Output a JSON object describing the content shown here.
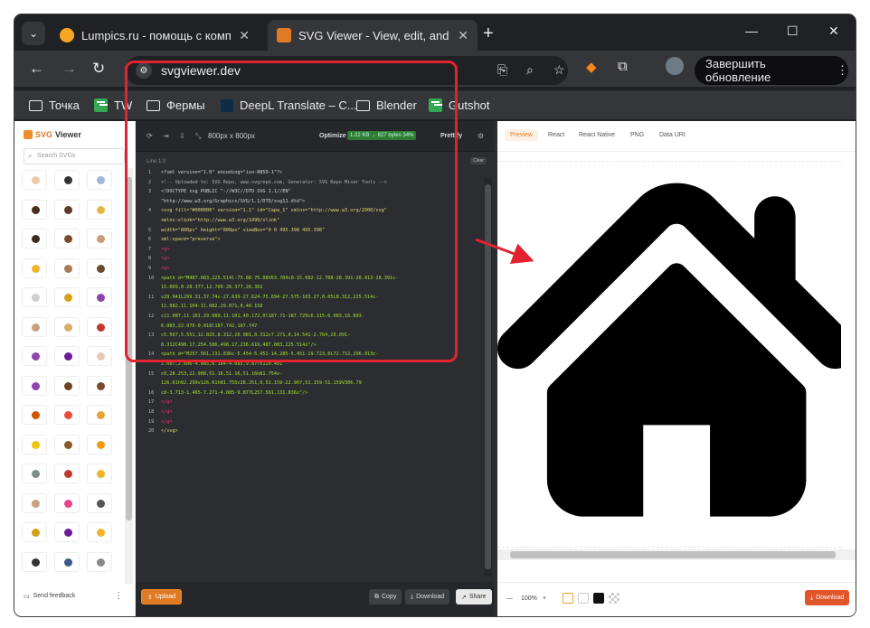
{
  "browser": {
    "tabs": [
      {
        "title": "Lumpics.ru - помощь с компь",
        "close": "✕"
      },
      {
        "title": "SVG Viewer - View, edit, and op",
        "close": "✕"
      }
    ],
    "new_tab": "+",
    "window_controls": {
      "minimize": "—",
      "maximize": "☐",
      "close": "✕"
    },
    "url": "svgviewer.dev",
    "update_button": "Завершить обновление",
    "bookmarks": [
      {
        "label": "Точка",
        "icon": "folder-icon"
      },
      {
        "label": "TW",
        "icon": "green-sheet-icon"
      },
      {
        "label": "Фермы",
        "icon": "folder-icon"
      },
      {
        "label": "DeepL Translate – C...",
        "icon": "deepl-icon"
      },
      {
        "label": "Blender",
        "icon": "folder-icon"
      },
      {
        "label": "Gutshot",
        "icon": "green-sheet-icon"
      }
    ]
  },
  "sidebar": {
    "logo_svg": "SVG",
    "logo_viewer": "Viewer",
    "search_placeholder": "Search SVGs",
    "feedback": "Send feedback",
    "icon_colors": [
      "#f2c9a8",
      "#333",
      "#9bb8d6",
      "#4a2d1f",
      "#5b3a29",
      "#e6b84a",
      "#3a2a1e",
      "#7a4a2e",
      "#c69c7a",
      "#f0b429",
      "#a87a55",
      "#6b4a2f",
      "#cfcfcf",
      "#d4a017",
      "#8e44ad",
      "#c9a27e",
      "#d4b06a",
      "#c0392b",
      "#8e44ad",
      "#6a1b9a",
      "#e8c8b0",
      "#8e44ad",
      "#6b4423",
      "#7a4a2e",
      "#d35400",
      "#e74c3c",
      "#e6a23c",
      "#f1c40f",
      "#8b5a2b",
      "#f39c12",
      "#7f8c8d",
      "#c0392b",
      "#f0b429",
      "#c9a27e",
      "#e84393",
      "#555",
      "#d4a017",
      "#6a1b9a",
      "#f0b429",
      "#333",
      "#3c5a8a",
      "#888"
    ]
  },
  "editor": {
    "dimensions": "800px x 800px",
    "optimize_label": "Optimize",
    "optimize_stats": "1.22 KB → 827 bytes 34%",
    "prettify": "Prettify",
    "line_info": "Line 1:0",
    "clear": "Clear",
    "code_lines": [
      {
        "n": "1",
        "text": "<?xml version=\"1.0\" encoding=\"iso-8859-1\"?>",
        "color": "#d7d7d7"
      },
      {
        "n": "2",
        "text": "<!-- Uploaded to: SVG Repo, www.svgrepo.com, Generator: SVG Repo Mixer Tools -->",
        "color": "#b0b0b0"
      },
      {
        "n": "3",
        "text": "<!DOCTYPE svg PUBLIC \"-//W3C//DTD SVG 1.1//EN\"",
        "color": "#d7d7d7"
      },
      {
        "n": "",
        "text": "\"http://www.w3.org/Graphics/SVG/1.1/DTD/svg11.dtd\">",
        "color": "#d7d7d7"
      },
      {
        "n": "4",
        "text": "<svg fill=\"#000000\" version=\"1.1\" id=\"Capa_1\" xmlns=\"http://www.w3.org/2000/svg\"",
        "color": "#e6db74"
      },
      {
        "n": "",
        "text": "xmlns:xlink=\"http://www.w3.org/1999/xlink\"",
        "color": "#e6db74"
      },
      {
        "n": "5",
        "text": "     width=\"800px\" height=\"800px\" viewBox=\"0 0 495.398 495.398\"",
        "color": "#e6db74"
      },
      {
        "n": "6",
        "text": "     xml:space=\"preserve\">",
        "color": "#e6db74"
      },
      {
        "n": "7",
        "text": "<g>",
        "color": "#f92672"
      },
      {
        "n": "8",
        "text": "     <g>",
        "color": "#f92672"
      },
      {
        "n": "9",
        "text": "          <g>",
        "color": "#f92672"
      },
      {
        "n": "10",
        "text": "               <path d=\"M487.083,225.514l-75.08-75.08V63.704c0-15.682-12.708-28.391-28.413-28.391c-",
        "color": "#a6e22e"
      },
      {
        "n": "",
        "text": "15.669,0-28.377,12.709-28.377,28.391",
        "color": "#a6e22e"
      },
      {
        "n": "11",
        "text": "                    v29.941L299.31,37.74c-27.639-27.624-75.694-27.575-103.27,0.05L8.312,225.514c-",
        "color": "#a6e22e"
      },
      {
        "n": "",
        "text": "11.082,11.104-11.082,29.071,0,40.158",
        "color": "#a6e22e"
      },
      {
        "n": "12",
        "text": "                    c11.087,11.101,29.089,11.101,40.172,0l187.71-187.729c6.115-6.083,16.893-",
        "color": "#a6e22e"
      },
      {
        "n": "",
        "text": "6.083,22.976-0.018l187.742,187.747",
        "color": "#a6e22e"
      },
      {
        "n": "13",
        "text": "                    c5.567,5.551,12.825,8.312,20.081,8.312c7.271,0,14.541-2.764,20.091-",
        "color": "#a6e22e"
      },
      {
        "n": "",
        "text": "8.312C498.17,254.586,498.17,236.619,487.083,225.514z\"/>",
        "color": "#a6e22e"
      },
      {
        "n": "14",
        "text": "               <path d=\"M257.561,131.836c-5.454-5.451-14.285-5.451-19.723,0L72.712,296.913c-",
        "color": "#a6e22e"
      },
      {
        "n": "",
        "text": "2.607,2.606-4.085,6.164-4.085,9.877v120.401",
        "color": "#a6e22e"
      },
      {
        "n": "15",
        "text": "                    c0,28.253,22.908,51.16,51.16,51.16h81.754v-",
        "color": "#a6e22e"
      },
      {
        "n": "",
        "text": "126.61h92.299v126.61h81.755c28.251,0,51.159-22.907,51.159-51.159V306.79",
        "color": "#a6e22e"
      },
      {
        "n": "16",
        "text": "                    c0-3.713-1.465-7.271-4.085-9.877L257.561,131.836z\"/>",
        "color": "#a6e22e"
      },
      {
        "n": "17",
        "text": "          </g>",
        "color": "#f92672"
      },
      {
        "n": "18",
        "text": "     </g>",
        "color": "#f92672"
      },
      {
        "n": "19",
        "text": "</g>",
        "color": "#f92672"
      },
      {
        "n": "20",
        "text": "</svg>",
        "color": "#e6db74"
      }
    ],
    "upload": "Upload",
    "copy": "Copy",
    "download": "Download",
    "share": "Share"
  },
  "preview": {
    "tabs": [
      "Preview",
      "React",
      "React Native",
      "PNG",
      "Data URI"
    ],
    "active_tab": "Preview",
    "zoom_minus": "—",
    "zoom_level": "100%",
    "zoom_plus": "+",
    "download": "Download",
    "bg_swatches": [
      "#ffffff",
      "#ffffff",
      "#111111",
      "checker"
    ]
  },
  "annotation": {
    "color": "#e0232e"
  }
}
